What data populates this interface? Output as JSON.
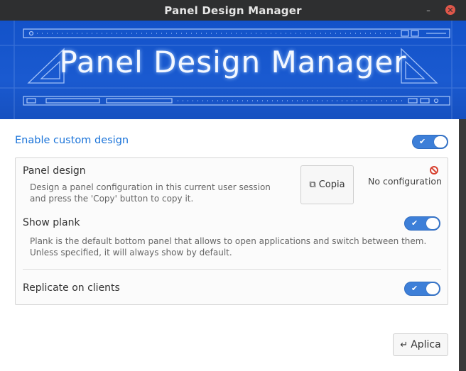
{
  "window": {
    "title": "Panel Design Manager"
  },
  "banner": {
    "title": "Panel Design Manager"
  },
  "enable_custom_design": {
    "label": "Enable custom design",
    "enabled": true
  },
  "panel_design": {
    "title": "Panel design",
    "description_line1": "Design a panel configuration in this current user session",
    "description_line2": "and press the 'Copy' button to copy it.",
    "copy_button_label": "Copia",
    "copy_icon": "copy-icon",
    "status_icon": "no-entry-icon",
    "status_label": "No configuration"
  },
  "show_plank": {
    "title": "Show plank",
    "description_line1": "Plank is the default bottom panel that allows to open applications and switch between them.",
    "description_line2": "Unless specified, it will always show by default.",
    "enabled": true
  },
  "replicate_on_clients": {
    "title": "Replicate on clients",
    "enabled": true
  },
  "footer": {
    "apply_button_label": "Aplica",
    "apply_icon": "return-arrow-icon"
  },
  "colors": {
    "accent": "#3d7fd8",
    "link": "#1a73d9",
    "banner": "#1a5ad0",
    "titlebar": "#2e2f30",
    "close": "#e0574a"
  }
}
